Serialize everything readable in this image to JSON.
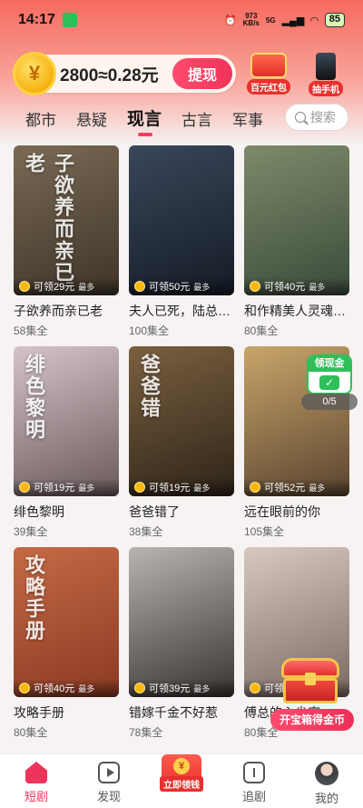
{
  "status_bar": {
    "time": "14:17",
    "net_speed": "973",
    "net_unit": "KB/s",
    "signal": "5G",
    "battery": "85"
  },
  "header": {
    "coin_symbol": "¥",
    "coins_text": "2800≈0.28元",
    "withdraw_label": "提现",
    "promo_hundred": "百元红包",
    "promo_phone": "抽手机"
  },
  "tabs": [
    {
      "label": "都市",
      "active": false
    },
    {
      "label": "悬疑",
      "active": false
    },
    {
      "label": "现言",
      "active": true
    },
    {
      "label": "古言",
      "active": false
    },
    {
      "label": "军事",
      "active": false
    }
  ],
  "search": {
    "placeholder": "搜索"
  },
  "dramas": [
    {
      "title": "子欲养而亲已老",
      "episodes": "58集全",
      "reward": "可领29元",
      "max": "最多",
      "poster_text": "子欲养而亲已老",
      "colors": [
        "#7a6a55",
        "#3e3428"
      ]
    },
    {
      "title": "夫人已死，陆总悔疯了",
      "episodes": "100集全",
      "reward": "可领50元",
      "max": "最多",
      "poster_text": "",
      "colors": [
        "#39475a",
        "#151b26"
      ]
    },
    {
      "title": "和作精美人灵魂互换后",
      "episodes": "80集全",
      "reward": "可领40元",
      "max": "最多",
      "poster_text": "",
      "colors": [
        "#7d8a6a",
        "#3b4b3a"
      ]
    },
    {
      "title": "绯色黎明",
      "episodes": "39集全",
      "reward": "可领19元",
      "max": "最多",
      "poster_text": "绯色黎明",
      "colors": [
        "#d4c4c8",
        "#6a5a5c"
      ]
    },
    {
      "title": "爸爸错了",
      "episodes": "38集全",
      "reward": "可领19元",
      "max": "最多",
      "poster_text": "爸爸错",
      "colors": [
        "#7a6040",
        "#2e2418"
      ]
    },
    {
      "title": "远在眼前的你",
      "episodes": "105集全",
      "reward": "可领52元",
      "max": "最多",
      "poster_text": "",
      "colors": [
        "#c9a56a",
        "#5a4430"
      ]
    },
    {
      "title": "攻略手册",
      "episodes": "80集全",
      "reward": "可领40元",
      "max": "最多",
      "poster_text": "攻略手册",
      "colors": [
        "#c46a45",
        "#8c3a24"
      ]
    },
    {
      "title": "错嫁千金不好惹",
      "episodes": "78集全",
      "reward": "可领39元",
      "max": "最多",
      "poster_text": "",
      "colors": [
        "#b8b4b0",
        "#3a3432"
      ]
    },
    {
      "title": "傅总的心尖宠",
      "episodes": "80集全",
      "reward": "可领40元",
      "max": "最多",
      "poster_text": "",
      "colors": [
        "#d8c8c0",
        "#7a6a64"
      ]
    }
  ],
  "floating": {
    "lingxian_label": "领现金",
    "progress": "0/5",
    "treasure_label": "开宝箱得金币"
  },
  "bottom_nav": {
    "home": "短剧",
    "discover": "发现",
    "center": "立即领钱",
    "follow": "追剧",
    "mine": "我的"
  }
}
